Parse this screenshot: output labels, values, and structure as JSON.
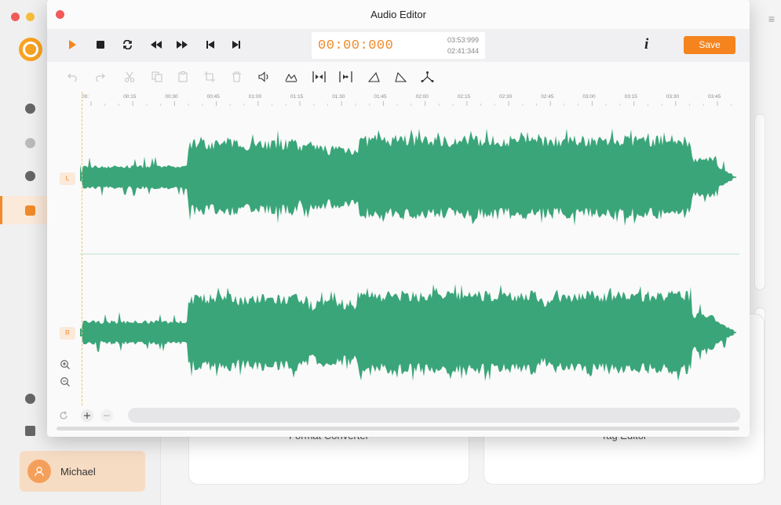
{
  "window": {
    "title": "Audio Editor"
  },
  "transport": {
    "timecode": "00:00:000",
    "total_time": "03:53:999",
    "selection_time": "02:41:344",
    "info_label": "i",
    "save_label": "Save"
  },
  "ruler": {
    "ticks": [
      "00:",
      "00:15",
      "00:30",
      "00:45",
      "01:00",
      "01:15",
      "01:30",
      "01:45",
      "02:00",
      "02:15",
      "02:30",
      "02:45",
      "03:00",
      "03:15",
      "03:30",
      "03:45"
    ]
  },
  "channels": {
    "left": "L",
    "right": "R"
  },
  "background_app": {
    "user_name": "Michael",
    "card_left_label": "Format Converter",
    "card_right_label": "Tag Editor",
    "menu_icon": "≡"
  },
  "colors": {
    "accent": "#f5841f",
    "waveform": "#3aa579",
    "playhead": "#f2c26b",
    "close": "#f05a5a"
  }
}
